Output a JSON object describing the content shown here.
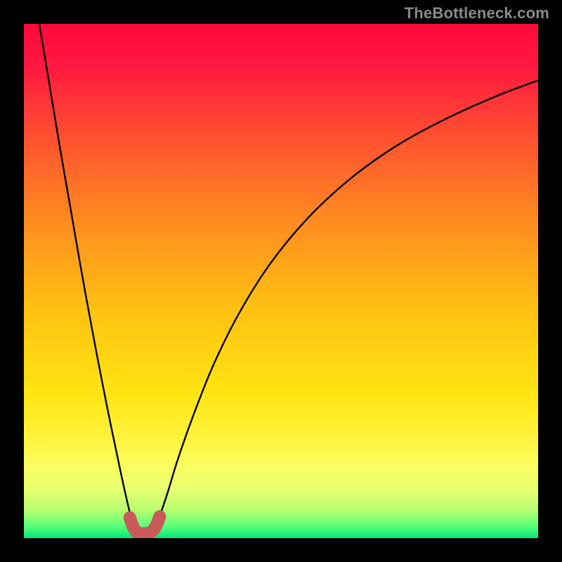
{
  "watermark": "TheBottleneck.com",
  "chart_data": {
    "type": "line",
    "title": "",
    "xlabel": "",
    "ylabel": "",
    "xlim": [
      0,
      100
    ],
    "ylim": [
      0,
      100
    ],
    "grid": false,
    "legend": false,
    "background_gradient": {
      "stops": [
        {
          "pos": 0.0,
          "color": "#ff0a3a"
        },
        {
          "pos": 0.08,
          "color": "#ff1840"
        },
        {
          "pos": 0.22,
          "color": "#ff5030"
        },
        {
          "pos": 0.38,
          "color": "#ff8a20"
        },
        {
          "pos": 0.55,
          "color": "#ffc012"
        },
        {
          "pos": 0.72,
          "color": "#ffe512"
        },
        {
          "pos": 0.8,
          "color": "#fff23a"
        },
        {
          "pos": 0.86,
          "color": "#faff60"
        },
        {
          "pos": 0.905,
          "color": "#e8ff70"
        },
        {
          "pos": 0.945,
          "color": "#b8ff70"
        },
        {
          "pos": 0.975,
          "color": "#60ff78"
        },
        {
          "pos": 1.0,
          "color": "#00e878"
        }
      ]
    },
    "series": [
      {
        "name": "left-branch",
        "color": "#000000",
        "x": [
          3.0,
          5.0,
          7.0,
          9.0,
          11.0,
          13.0,
          15.0,
          17.0,
          19.0,
          20.0,
          20.8,
          21.4,
          21.8
        ],
        "y": [
          100.0,
          88.0,
          76.0,
          64.5,
          53.0,
          42.0,
          31.5,
          21.5,
          12.0,
          7.5,
          4.2,
          2.2,
          1.2
        ]
      },
      {
        "name": "right-branch",
        "color": "#000000",
        "x": [
          25.2,
          25.8,
          26.6,
          28.0,
          30.0,
          33.0,
          37.0,
          42.0,
          48.0,
          55.0,
          63.0,
          72.0,
          82.0,
          92.0,
          100.0
        ],
        "y": [
          1.2,
          2.4,
          4.8,
          9.0,
          15.5,
          24.0,
          34.0,
          44.0,
          53.5,
          62.0,
          69.5,
          76.0,
          81.5,
          86.0,
          89.0
        ]
      },
      {
        "name": "trough-marker",
        "color": "#c85a5a",
        "style": "thick",
        "x": [
          20.6,
          21.2,
          21.9,
          22.6,
          23.4,
          24.2,
          25.0,
          25.8,
          26.4
        ],
        "y": [
          4.0,
          2.3,
          1.2,
          0.9,
          0.9,
          1.0,
          1.4,
          2.6,
          4.2
        ]
      }
    ]
  }
}
